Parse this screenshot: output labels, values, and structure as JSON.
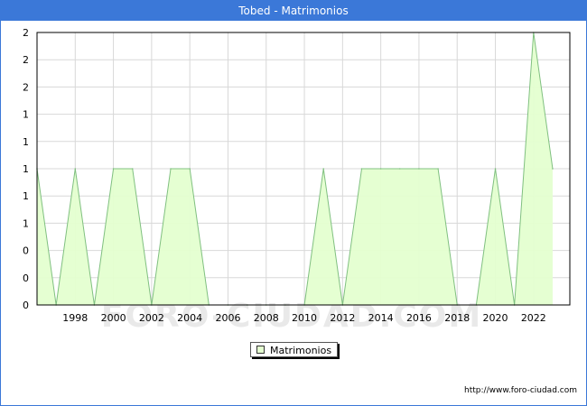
{
  "title": "Tobed - Matrimonios",
  "source": "http://www.foro-ciudad.com",
  "watermark": "FORO-CIUDAD.COM",
  "colors": {
    "header": "#3b78d8",
    "fill": "#e4ffd0",
    "line": "#80c080",
    "grid": "#d8d8d8"
  },
  "chart_data": {
    "type": "area",
    "x": [
      1996,
      1997,
      1998,
      1999,
      2000,
      2001,
      2002,
      2003,
      2004,
      2005,
      2006,
      2007,
      2008,
      2009,
      2010,
      2011,
      2012,
      2013,
      2014,
      2015,
      2016,
      2017,
      2018,
      2019,
      2020,
      2021,
      2022,
      2023
    ],
    "series": [
      {
        "name": "Matrimonios",
        "values": [
          1,
          0,
          1,
          0,
          1,
          1,
          0,
          1,
          1,
          0,
          0,
          0,
          0,
          0,
          0,
          1,
          0,
          1,
          1,
          1,
          1,
          1,
          0,
          0,
          1,
          0,
          2,
          1
        ]
      }
    ],
    "xlim": [
      1996,
      2023.9
    ],
    "ylim": [
      0,
      2
    ],
    "x_ticks": [
      1998,
      2000,
      2002,
      2004,
      2006,
      2008,
      2010,
      2012,
      2014,
      2016,
      2018,
      2020,
      2022
    ],
    "y_ticks": [
      0,
      0.2,
      0.4,
      0.6,
      0.8,
      1.0,
      1.2,
      1.4,
      1.6,
      1.8,
      2.0
    ],
    "y_tick_labels": [
      "0",
      "0",
      "0",
      "1",
      "1",
      "1",
      "1",
      "1",
      "2",
      "2",
      "2"
    ],
    "grid": true,
    "legend_position": "bottom-center"
  }
}
